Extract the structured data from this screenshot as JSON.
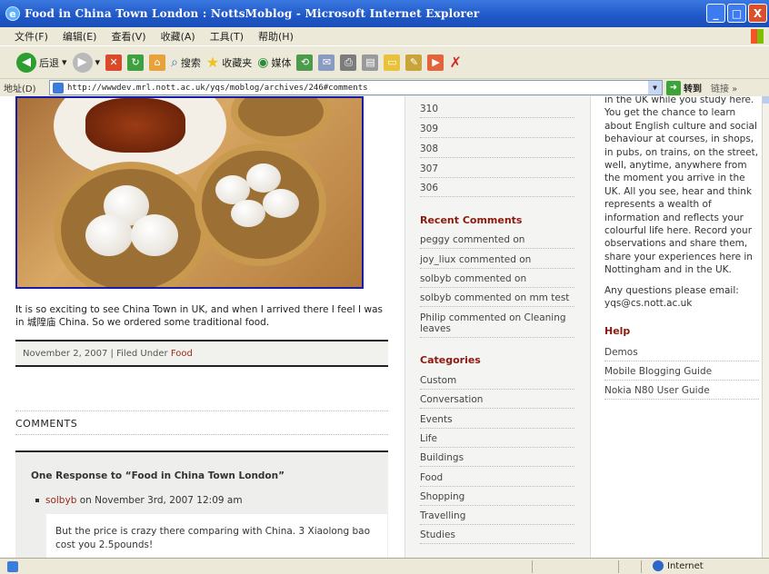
{
  "window": {
    "title": "Food in China Town London : NottsMoblog - Microsoft Internet Explorer",
    "buttons": [
      "_",
      "□",
      "X"
    ]
  },
  "menu": [
    "文件(F)",
    "编辑(E)",
    "查看(V)",
    "收藏(A)",
    "工具(T)",
    "帮助(H)"
  ],
  "toolbar": {
    "back": "后退",
    "search": "搜索",
    "favorites": "收藏夹",
    "media": "媒体"
  },
  "address": {
    "label": "地址(D)",
    "url": "http://wwwdev.mrl.nott.ac.uk/yqs/moblog/archives/246#comments",
    "go": "转到",
    "links": "链接 »"
  },
  "post": {
    "text": "It is so exciting to see China Town in UK, and when I arrived there I feel I was in 城隍庙 China. So we ordered some traditional food.",
    "date": "November 2, 2007",
    "filed_under": "Filed Under",
    "category": "Food"
  },
  "comments": {
    "heading": "COMMENTS",
    "response_title": "One Response to “Food in China Town London”",
    "author": "solbyb",
    "date": "on November 3rd, 2007 12:09 am",
    "body": "But the price is crazy there comparing with China. 3 Xiaolong bao cost you 2.5pounds!"
  },
  "sidebar": {
    "archives": [
      "310",
      "309",
      "308",
      "307",
      "306"
    ],
    "recent_heading": "Recent Comments",
    "recent": [
      "peggy commented on",
      "joy_liux commented on",
      "solbyb commented on",
      "solbyb commented on mm test",
      "Philip commented on Cleaning leaves"
    ],
    "categories_heading": "Categories",
    "categories": [
      "Custom",
      "Conversation",
      "Events",
      "Life",
      "Buildings",
      "Food",
      "Shopping",
      "Travelling",
      "Studies"
    ]
  },
  "about": {
    "text": "in the UK while you study here. You get the chance to learn about English culture and social behaviour at courses, in shops, in pubs, on trains, on the street, well, anytime, anywhere from the moment you arrive in the UK. All you see, hear and think represents a wealth of information and reflects your colourful life here. Record your observations and share them, share your experiences here in Nottingham and in the UK.",
    "contact": "Any questions please email: yqs@cs.nott.ac.uk",
    "help_heading": "Help",
    "help": [
      "Demos",
      "Mobile Blogging Guide",
      "Nokia N80 User Guide"
    ]
  },
  "status": {
    "zone": "Internet"
  },
  "colors": {
    "accent": "#8b1a10",
    "link": "#9a2a1a",
    "titlebar": "#1f57c8"
  }
}
